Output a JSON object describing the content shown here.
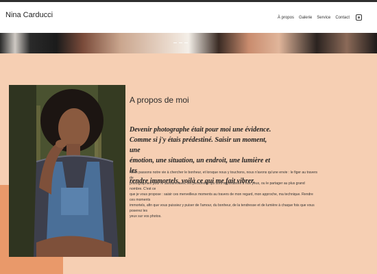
{
  "header": {
    "brand": "Nina Carducci",
    "nav": [
      "À propos",
      "Galerie",
      "Service",
      "Contact"
    ],
    "social_icon": "instagram-icon"
  },
  "about": {
    "title": "A propos de moi",
    "quote_lines": [
      "Devenir photographe était pour moi une évidence.",
      "Comme si j'y étais prédestiné. Saisir un moment, une",
      "émotion, une situation, un endroit, une lumière et les",
      "rendre immortels, voilà ce qui me fait vibrer."
    ],
    "body_lines": [
      "Nous passons notre vie à chercher le bonheur, et lorsque nous y touchons, nous n'avons qu'une envie : le figer au travers de",
      "photographies pour le savourer avec les personnes qui sont importantes à nos yeux, ou le partager au plus grand nombre. C'est ce",
      "que je vous propose : saisir ces merveilleux moments au travers de mon regard, mon approche, ma technique. Rendre ces moments",
      "immortels, afin que vous puissiez y puiser de l'amour, du bonheur, de la tendresse et de lumière à chaque fois que vous poserez les",
      "yeux sur vos photos."
    ]
  },
  "colors": {
    "background": "#f6cfb3",
    "accent_block": "#e9996a",
    "header_bg": "#ffffff"
  }
}
